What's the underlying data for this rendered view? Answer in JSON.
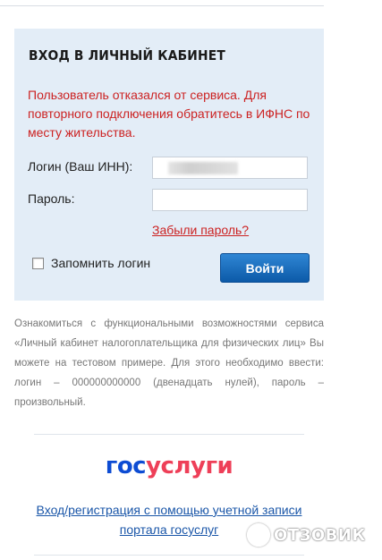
{
  "login_panel": {
    "title": "ВХОД В ЛИЧНЫЙ КАБИНЕТ",
    "error_message": "Пользователь отказался от сервиса. Для повторного подключения обратитесь в ИФНС по месту жительства.",
    "login_label": "Логин (Ваш ИНН):",
    "login_value": "",
    "password_label": "Пароль:",
    "password_value": "",
    "forgot_password": "Забыли пароль?",
    "remember_label": "Запомнить логин",
    "remember_checked": false,
    "submit_label": "Войти"
  },
  "info_text": "Ознакомиться с функциональными возможностями сервиса «Личный кабинет налогоплательщика для физических лиц» Вы можете на тестовом примере. Для этого необходимо ввести: логин – 000000000000 (двенадцать нулей), пароль – произвольный.",
  "gosuslugi": {
    "logo_part1": "гос",
    "logo_part2": "услуги",
    "link_text": "Вход/регистрация с помощью учетной записи портала госуслуг"
  },
  "watermark": {
    "text": "ОТЗОВИК"
  },
  "colors": {
    "panel_bg": "#e3edf7",
    "error": "#cc2222",
    "button": "#0c5aa8",
    "link": "#1a56a8",
    "logo_blue": "#0d4cd3",
    "logo_red": "#ee3f58"
  },
  "icons": [
    "checkbox-icon",
    "otzovik-logo-icon"
  ]
}
